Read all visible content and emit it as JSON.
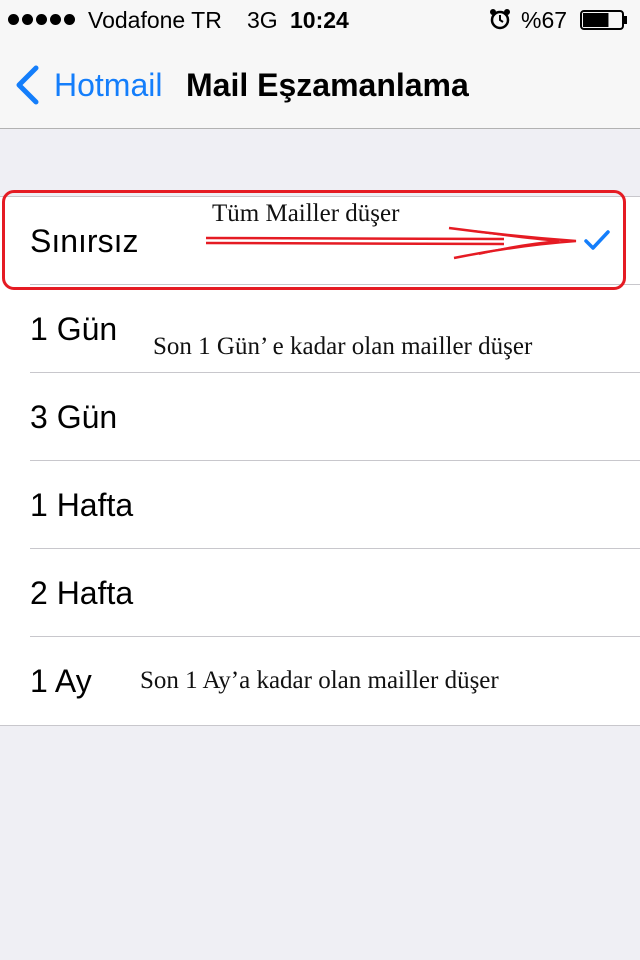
{
  "status_bar": {
    "carrier": "Vodafone TR",
    "network": "3G",
    "time": "10:24",
    "battery_percent": "%67",
    "battery_level": 0.67,
    "signal_bars": 5
  },
  "nav": {
    "back_label": "Hotmail",
    "title": "Mail Eşzamanlama"
  },
  "options": [
    {
      "label": "Sınırsız",
      "selected": true
    },
    {
      "label": "1 Gün",
      "selected": false
    },
    {
      "label": "3 Gün",
      "selected": false
    },
    {
      "label": "1 Hafta",
      "selected": false
    },
    {
      "label": "2 Hafta",
      "selected": false
    },
    {
      "label": "1 Ay",
      "selected": false
    }
  ],
  "annotations": {
    "unlimited": "Tüm Mailler düşer",
    "one_day": "Son 1 Gün’ e kadar olan mailler düşer",
    "one_month": "Son 1 Ay’a kadar olan mailler düşer"
  },
  "colors": {
    "accent": "#147efb",
    "annotation_red": "#e51b23",
    "background": "#efeff4"
  }
}
